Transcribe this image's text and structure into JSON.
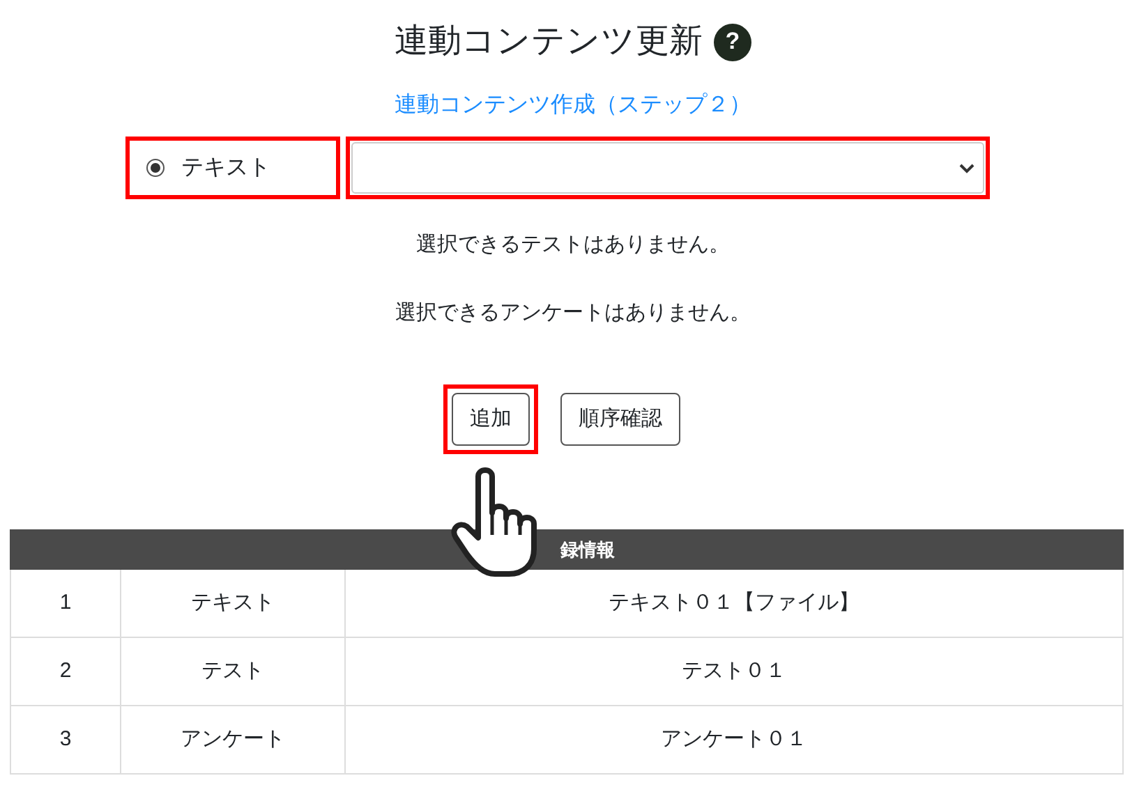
{
  "title": "連動コンテンツ更新",
  "help_icon": "?",
  "step_link": "連動コンテンツ作成（ステップ２）",
  "content_type": {
    "label": "テキスト",
    "selected": true,
    "highlighted": true
  },
  "content_select": {
    "highlighted": true
  },
  "messages": [
    "選択できるテストはありません。",
    "選択できるアンケートはありません。"
  ],
  "buttons": [
    {
      "label": "追加",
      "highlighted": true
    },
    {
      "label": "順序確認",
      "highlighted": false
    }
  ],
  "table": {
    "title": "録情報",
    "rows": [
      {
        "number": "1",
        "type": "テキスト",
        "name": "テキスト０１【ファイル】"
      },
      {
        "number": "2",
        "type": "テスト",
        "name": "テスト０１"
      },
      {
        "number": "3",
        "type": "アンケート",
        "name": "アンケート０１"
      }
    ]
  }
}
